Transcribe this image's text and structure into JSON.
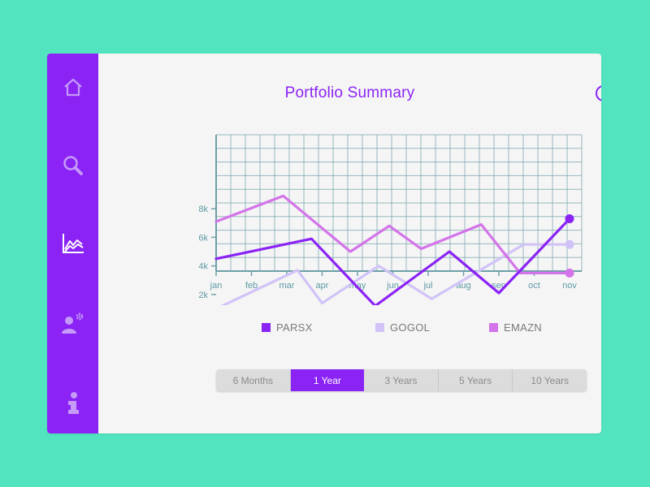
{
  "page": {
    "title": "Portfolio Summary"
  },
  "colors": {
    "brand": "#8b23f5",
    "background": "#52e3bf",
    "grid": "#6f9fa8"
  },
  "sidebar": {
    "items": [
      {
        "name": "home",
        "icon": "home-icon",
        "active": false
      },
      {
        "name": "search",
        "icon": "search-icon",
        "active": false
      },
      {
        "name": "chart",
        "icon": "line-chart-icon",
        "active": true
      },
      {
        "name": "user-settings",
        "icon": "user-gear-icon",
        "active": false
      },
      {
        "name": "info",
        "icon": "info-icon",
        "active": false
      }
    ]
  },
  "header": {
    "pie_icon": "pie-chart-icon"
  },
  "chart_data": {
    "type": "line",
    "title": "",
    "xlabel": "",
    "ylabel": "",
    "categories": [
      "jan",
      "feb",
      "mar",
      "apr",
      "may",
      "jun",
      "jul",
      "aug",
      "sep",
      "oct",
      "nov"
    ],
    "y_ticks": [
      "2k",
      "4k",
      "6k",
      "8k"
    ],
    "y_tick_values": [
      2000,
      4000,
      6000,
      8000
    ],
    "ylim": [
      0,
      10000
    ],
    "grid": true,
    "legend_position": "bottom",
    "series": [
      {
        "name": "PARSX",
        "color": "#8b23f5",
        "points": [
          [
            0,
            4500
          ],
          [
            2.7,
            5900
          ],
          [
            4.5,
            1200
          ],
          [
            6.6,
            5000
          ],
          [
            8,
            2100
          ],
          [
            10,
            7300
          ]
        ]
      },
      {
        "name": "GOGOL",
        "color": "#d1c3f7",
        "points": [
          [
            0,
            1000
          ],
          [
            2.3,
            3700
          ],
          [
            3,
            1400
          ],
          [
            4.6,
            4000
          ],
          [
            6.1,
            1700
          ],
          [
            8.7,
            5500
          ],
          [
            10,
            5500
          ]
        ]
      },
      {
        "name": "EMAZN",
        "color": "#d474ea",
        "points": [
          [
            0,
            7100
          ],
          [
            1.9,
            8900
          ],
          [
            3.8,
            5000
          ],
          [
            4.9,
            6800
          ],
          [
            5.8,
            5200
          ],
          [
            7.5,
            6900
          ],
          [
            8.6,
            3500
          ],
          [
            10,
            3500
          ]
        ]
      }
    ]
  },
  "legend": {
    "items": [
      {
        "label": "PARSX",
        "color": "#8b23f5"
      },
      {
        "label": "GOGOL",
        "color": "#d1c3f7"
      },
      {
        "label": "EMAZN",
        "color": "#d474ea"
      }
    ]
  },
  "range_selector": {
    "options": [
      "6 Months",
      "1 Year",
      "3 Years",
      "5 Years",
      "10 Years"
    ],
    "selected": "1 Year"
  }
}
